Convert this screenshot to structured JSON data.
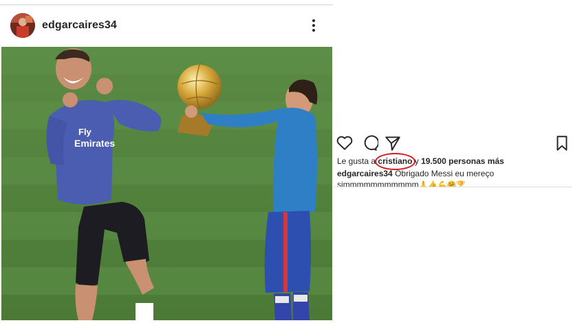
{
  "post": {
    "username": "edgarcaires34"
  },
  "actions": {
    "like_icon": "heart-icon",
    "comment_icon": "comment-icon",
    "share_icon": "share-icon",
    "save_icon": "bookmark-icon"
  },
  "likes": {
    "prefix": "Le gusta a ",
    "highlighted_user": "cristiano",
    "connector": " y ",
    "count_text": "19.500 personas más",
    "highlight_color": "#d11b1b"
  },
  "caption": {
    "user": "edgarcaires34",
    "text": " Obrigado Messi eu mereço simmmmmmmmmmm",
    "emoji": "🙏👍💪🤗🏆"
  }
}
